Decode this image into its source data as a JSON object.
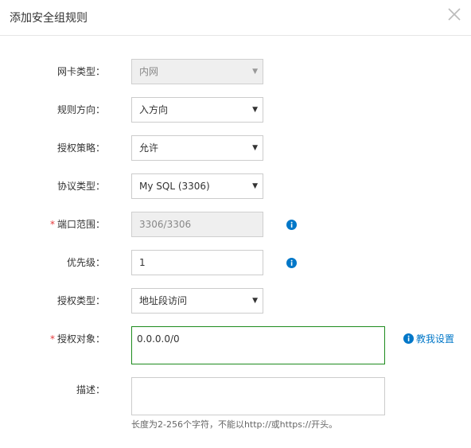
{
  "dialog": {
    "title": "添加安全组规则",
    "close_icon": "close-icon"
  },
  "form": {
    "nic_type": {
      "label": "网卡类型：",
      "value": "内网",
      "disabled": true
    },
    "direction": {
      "label": "规则方向：",
      "value": "入方向"
    },
    "policy": {
      "label": "授权策略：",
      "value": "允许"
    },
    "protocol": {
      "label": "协议类型：",
      "value": "My SQL (3306)"
    },
    "port_range": {
      "required_mark": "*",
      "label": "端口范围：",
      "value": "3306/3306",
      "disabled": true
    },
    "priority": {
      "label": "优先级：",
      "value": "1"
    },
    "auth_type": {
      "label": "授权类型：",
      "value": "地址段访问"
    },
    "auth_target": {
      "required_mark": "*",
      "label": "授权对象：",
      "value": "0.0.0.0/0",
      "help_link": "教我设置"
    },
    "description": {
      "label": "描述：",
      "value": "",
      "hint": "长度为2-256个字符，不能以http://或https://开头。"
    }
  },
  "colors": {
    "accent_blue": "#0077c8",
    "required_red": "#e4393c",
    "focus_green": "#1e8b1e"
  }
}
